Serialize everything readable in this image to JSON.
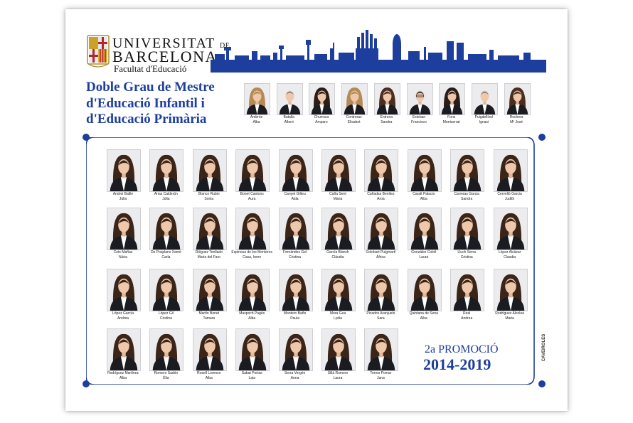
{
  "university": {
    "line1": "UNIVERSITAT",
    "line1_suffix": "DE",
    "line2": "BARCELONA",
    "faculty": "Facultat d'Educació"
  },
  "degree_title": {
    "line1": "Doble Grau de Mestre",
    "line2": "d'Educació Infantil i",
    "line3": "d'Educació Primària"
  },
  "promotion": {
    "label": "2a PROMOCIÓ",
    "years": "2014-2019"
  },
  "studio_name": "CAVEIROLES",
  "colors": {
    "brand_blue": "#1d3e9c",
    "background": "#ffffff"
  },
  "faculty_members": [
    {
      "surname": "Ambròs",
      "name": "Alba",
      "look": "f-blonde"
    },
    {
      "surname": "Batalla",
      "name": "Albert",
      "look": "m-grey"
    },
    {
      "surname": "Churruca",
      "name": "Amparo",
      "look": "f-dark"
    },
    {
      "surname": "Contreras",
      "name": "Elisabet",
      "look": "f-blonde"
    },
    {
      "surname": "Entrena",
      "name": "Sandra",
      "look": "f-brown"
    },
    {
      "surname": "Esteban",
      "name": "Francisco",
      "look": "m-glasses"
    },
    {
      "surname": "Fons",
      "name": "Montserrat",
      "look": "f-dark"
    },
    {
      "surname": "Puigdellívol",
      "name": "Ignasi",
      "look": "m-grey"
    },
    {
      "surname": "Rochera",
      "name": "Mª José",
      "look": "f-brown"
    }
  ],
  "students": [
    [
      {
        "surname": "Andrei Batlle",
        "name": "Júlia"
      },
      {
        "surname": "Arias Calderón",
        "name": "Júlia"
      },
      {
        "surname": "Blanco Rubio",
        "name": "Sonia"
      },
      {
        "surname": "Bonet Cantons",
        "name": "Aura"
      },
      {
        "surname": "Canyet Gilteu",
        "name": "Aida"
      },
      {
        "surname": "Caña Seró",
        "name": "Maria"
      },
      {
        "surname": "Cañadas Benítez",
        "name": "Aroa"
      },
      {
        "surname": "Caralt Palacio",
        "name": "Alba"
      },
      {
        "surname": "Carreras Garcia",
        "name": "Sandra"
      },
      {
        "surname": "Cervelló Garcia",
        "name": "Judith"
      }
    ],
    [
      {
        "surname": "Cots Mañas",
        "name": "Núria"
      },
      {
        "surname": "De Posplans Xamé",
        "name": "Carla"
      },
      {
        "surname": "Diéguez Tenllado",
        "name": "Maria del Faro"
      },
      {
        "surname": "Espinosa de los Monteros",
        "name": "Casa, Irene"
      },
      {
        "surname": "Fernández Gel",
        "name": "Cristina"
      },
      {
        "surname": "García Blanch",
        "name": "Clàudia"
      },
      {
        "surname": "Golobart Puigmartí",
        "name": "Àfrica"
      },
      {
        "surname": "González Cololl",
        "name": "Laura"
      },
      {
        "surname": "Lluch Serra",
        "name": "Cristina"
      },
      {
        "surname": "López Alcázar",
        "name": "Claudia"
      }
    ],
    [
      {
        "surname": "López García",
        "name": "Andrea"
      },
      {
        "surname": "López Gil",
        "name": "Cristina"
      },
      {
        "surname": "Martín Bonet",
        "name": "Tamara"
      },
      {
        "surname": "Maspoch Pagès",
        "name": "Alba"
      },
      {
        "surname": "Montero Baño",
        "name": "Paula"
      },
      {
        "surname": "Mora Gea",
        "name": "Lydia"
      },
      {
        "surname": "Picados Aranjuelo",
        "name": "Sara"
      },
      {
        "surname": "Quintana de Sena",
        "name": "Alba"
      },
      {
        "surname": "Real",
        "name": "Andrea"
      },
      {
        "surname": "Rodríguez Alcolea",
        "name": "Maria"
      }
    ],
    [
      {
        "surname": "Rodríguez Martínez",
        "name": "Alba"
      },
      {
        "surname": "Romero Sadón",
        "name": "Èlia"
      },
      {
        "surname": "Rosell Lorenzo",
        "name": "Alba"
      },
      {
        "surname": "Sabat Portas",
        "name": "Laia"
      },
      {
        "surname": "Serra Vergés",
        "name": "Anna"
      },
      {
        "surname": "Sillà Romero",
        "name": "Laura"
      },
      {
        "surname": "Torres Pomar",
        "name": "Jana"
      }
    ]
  ]
}
